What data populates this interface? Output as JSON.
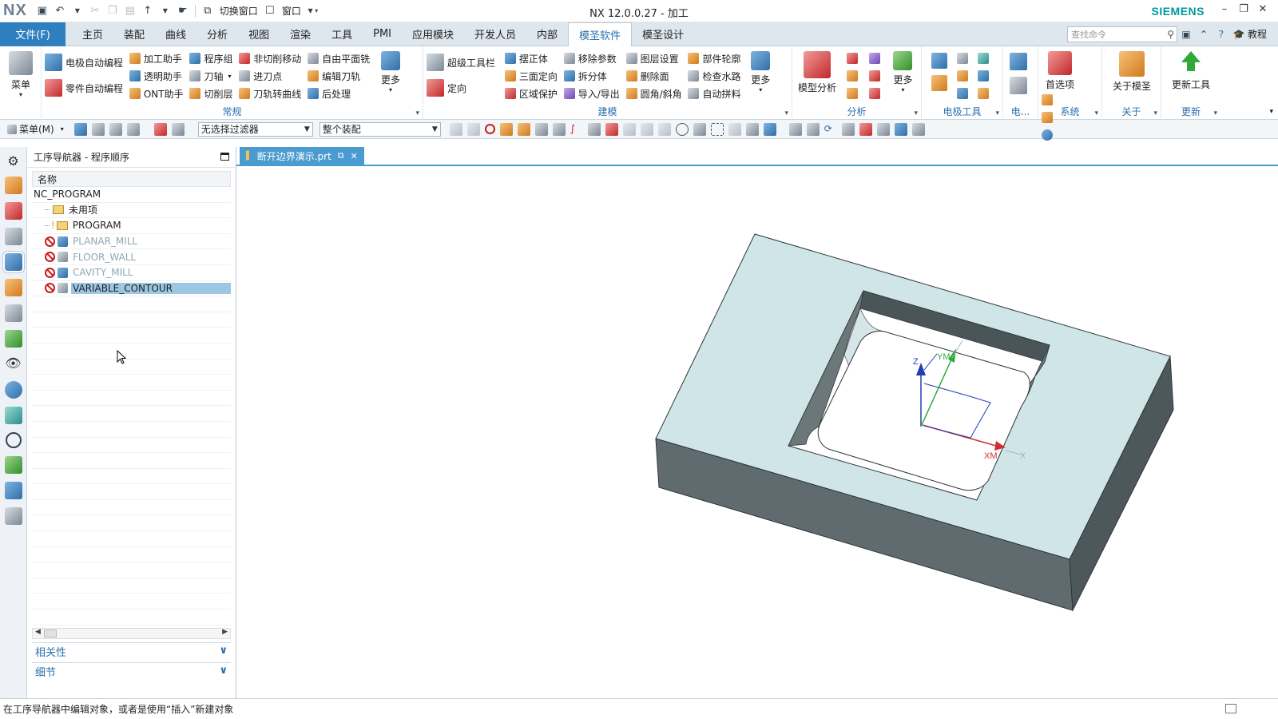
{
  "titlebar": {
    "logo": "NX",
    "title": "NX 12.0.0.27 - 加工",
    "brand": "SIEMENS",
    "switch_window": "切换窗口",
    "window_menu": "窗口"
  },
  "menubar": {
    "file": "文件(F)",
    "tabs": [
      "主页",
      "装配",
      "曲线",
      "分析",
      "视图",
      "渲染",
      "工具",
      "PMI",
      "应用模块",
      "开发人员",
      "内部",
      "模圣软件",
      "模圣设计"
    ],
    "active_tab": "模圣软件",
    "search_placeholder": "查找命令",
    "tutorial": "教程"
  },
  "ribbon": {
    "menu_btn": "菜单",
    "group_general": {
      "label": "常规",
      "col1": [
        "电极自动编程",
        "零件自动编程"
      ],
      "col2": [
        "加工助手",
        "透明助手",
        "ONT助手"
      ],
      "col3": [
        "程序组",
        "刀轴",
        "切削层"
      ],
      "col4": [
        "非切削移动",
        "进刀点",
        "刀轨转曲线"
      ],
      "col5": [
        "自由平面铣",
        "编辑刀轨",
        "后处理"
      ],
      "more": "更多"
    },
    "group_modeling": {
      "label": "建模",
      "col1": [
        "超级工具栏",
        "定向"
      ],
      "col2": [
        "摆正体",
        "三面定向",
        "区域保护"
      ],
      "col3": [
        "移除参数",
        "拆分体",
        "导入/导出"
      ],
      "col4": [
        "图层设置",
        "删除面",
        "圆角/斜角"
      ],
      "col5": [
        "部件轮廓",
        "检查水路",
        "自动拼料"
      ],
      "more": "更多"
    },
    "group_analysis": {
      "label": "分析",
      "model_analysis": "模型分析",
      "more": "更多"
    },
    "group_electrode": {
      "label": "电极工具"
    },
    "group_e2": {
      "label": "电..."
    },
    "group_system": {
      "label": "系统",
      "preferences": "首选项"
    },
    "group_about": {
      "label": "关于",
      "about": "关于模圣"
    },
    "group_update": {
      "label": "更新",
      "update_tool": "更新工具"
    }
  },
  "toolbar": {
    "menu": "菜单(M)",
    "filter": "无选择过滤器",
    "assembly": "整个装配"
  },
  "navigator": {
    "title": "工序导航器 - 程序顺序",
    "column_name": "名称",
    "root": "NC_PROGRAM",
    "items": [
      {
        "name": "未用项",
        "type": "folder"
      },
      {
        "name": "PROGRAM",
        "type": "program"
      },
      {
        "name": "PLANAR_MILL",
        "type": "op"
      },
      {
        "name": "FLOOR_WALL",
        "type": "op"
      },
      {
        "name": "CAVITY_MILL",
        "type": "op"
      },
      {
        "name": "VARIABLE_CONTOUR",
        "type": "op"
      }
    ],
    "selected": "VARIABLE_CONTOUR",
    "section_dependency": "相关性",
    "section_details": "细节"
  },
  "document": {
    "tab": "断开边界演示.prt"
  },
  "viewport": {
    "axis_x": "X",
    "axis_xm": "XM",
    "axis_ym": "YM",
    "axis_z": "Z",
    "colors": {
      "part_top": "#cde3e6",
      "part_side": "#5f6b6e",
      "part_side_dark": "#4a5558",
      "pocket_floor": "#ffffff"
    }
  },
  "status": {
    "message": "在工序导航器中编辑对象，或者是使用“插入”新建对象"
  }
}
